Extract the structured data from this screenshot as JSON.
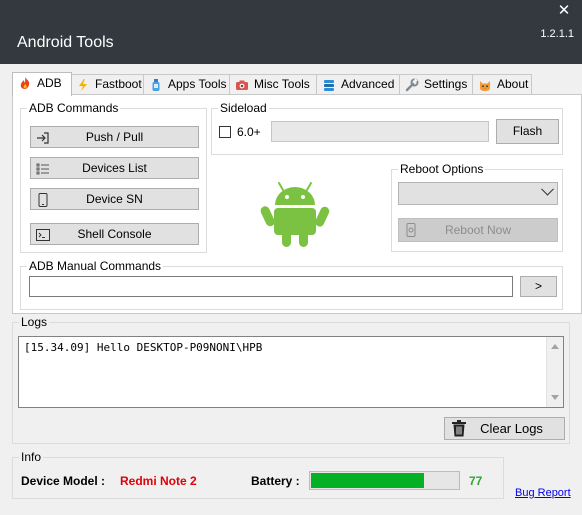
{
  "window": {
    "title": "Android Tools",
    "version": "1.2.1.1",
    "close_glyph": "✕"
  },
  "tabs": [
    {
      "label": "ADB",
      "icon": "fire-icon",
      "active": true
    },
    {
      "label": "Fastboot",
      "icon": "lightning-icon"
    },
    {
      "label": "Apps Tools",
      "icon": "bottle-icon"
    },
    {
      "label": "Misc Tools",
      "icon": "camera-icon"
    },
    {
      "label": "Advanced",
      "icon": "stack-icon"
    },
    {
      "label": "Settings",
      "icon": "wrench-icon"
    },
    {
      "label": "About",
      "icon": "cat-icon"
    }
  ],
  "adb_commands": {
    "title": "ADB Commands",
    "push_pull": "Push / Pull",
    "devices_list": "Devices List",
    "device_sn": "Device SN",
    "shell_console": "Shell Console"
  },
  "sideload": {
    "title": "Sideload",
    "checkbox_label": "6.0+",
    "checked": false,
    "path_value": "",
    "flash_label": "Flash"
  },
  "reboot": {
    "title": "Reboot Options",
    "selected": "",
    "reboot_now_label": "Reboot Now",
    "reboot_now_enabled": false
  },
  "manual": {
    "title": "ADB Manual Commands",
    "command_value": "",
    "send_label": ">"
  },
  "logs": {
    "title": "Logs",
    "lines": [
      "[15.34.09] Hello DESKTOP-P09NONI\\HPB"
    ],
    "clear_label": "Clear Logs"
  },
  "info": {
    "title": "Info",
    "device_model_label": "Device Model :",
    "device_model_value": "Redmi Note 2",
    "battery_label": "Battery :",
    "battery_value": "77",
    "battery_percent": 77
  },
  "bug_report_label": "Bug Report",
  "colors": {
    "accent_red": "#e0000a",
    "battery_green": "#06b025",
    "battery_text": "#2ea62e",
    "android_green": "#7cc242",
    "titlebar": "#33393f"
  }
}
